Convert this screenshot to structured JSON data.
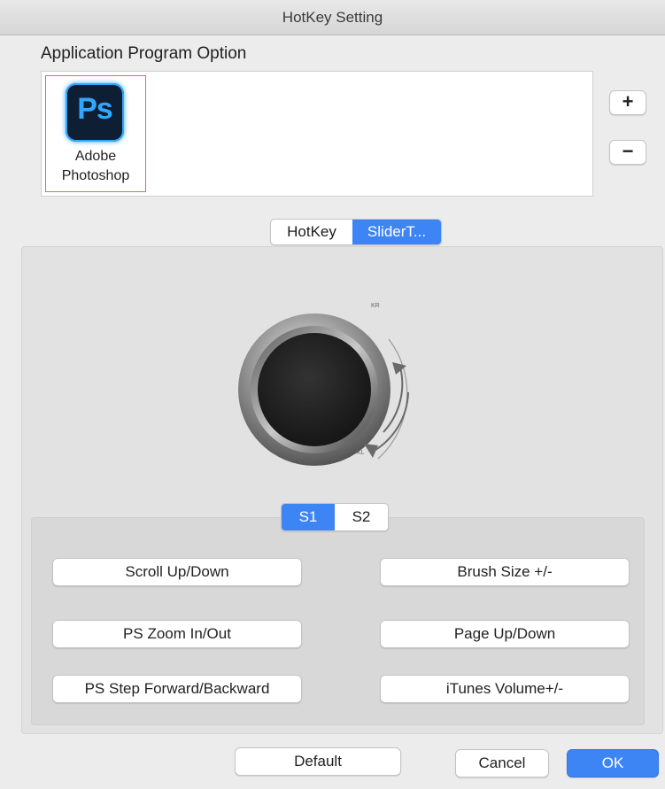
{
  "window": {
    "title": "HotKey Setting"
  },
  "app_section": {
    "label": "Application Program Option",
    "apps": [
      {
        "icon_text": "Ps",
        "name_line1": "Adobe",
        "name_line2": "Photoshop",
        "icon": "photoshop-icon",
        "selected": true
      }
    ],
    "add_label": "+",
    "remove_label": "−"
  },
  "mode_tabs": [
    {
      "label": "HotKey",
      "active": false
    },
    {
      "label": "SliderT...",
      "active": true
    }
  ],
  "dial": {
    "top_label": "KR",
    "bottom_label": "KL"
  },
  "slot_tabs": [
    {
      "label": "S1",
      "active": true
    },
    {
      "label": "S2",
      "active": false
    }
  ],
  "functions": {
    "left": [
      "Scroll Up/Down",
      "PS Zoom In/Out",
      "PS Step Forward/Backward"
    ],
    "right": [
      "Brush Size +/-",
      "Page Up/Down",
      "iTunes Volume+/-"
    ]
  },
  "footer": {
    "default_label": "Default",
    "cancel_label": "Cancel",
    "ok_label": "OK"
  },
  "colors": {
    "accent": "#3d84f5",
    "ps_blue": "#31a8ff",
    "selection_border": "#e06a6a"
  }
}
